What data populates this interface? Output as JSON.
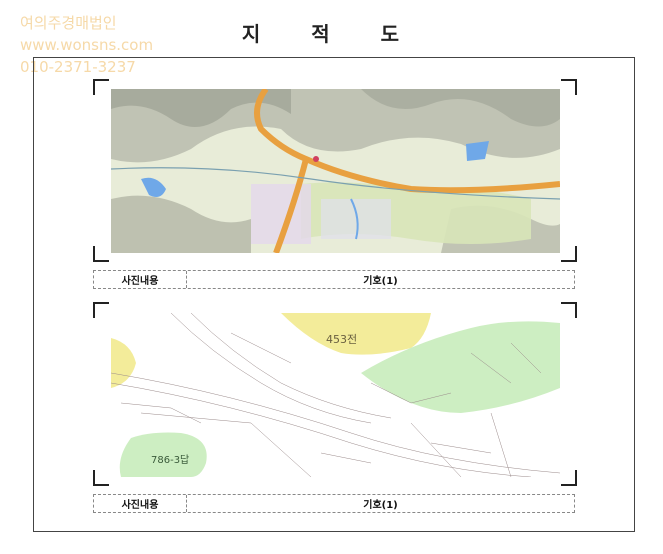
{
  "watermark": {
    "company": "여의주경매법인",
    "website": "www.wonsns.com",
    "phone": "010-2371-3237"
  },
  "title": "지 적 도",
  "panels": [
    {
      "caption_label": "사진내용",
      "caption_value": "기호(1)",
      "map_labels": []
    },
    {
      "caption_label": "사진내용",
      "caption_value": "기호(1)",
      "map_labels": [
        "453전",
        "786-3답"
      ]
    }
  ],
  "colors": {
    "frame": "#444444",
    "watermark": "#f6d9a8",
    "road": "#e8a040",
    "water": "#6fa8e8",
    "parcel_yellow": "#f3ec9a",
    "parcel_green": "#cdeec2"
  }
}
